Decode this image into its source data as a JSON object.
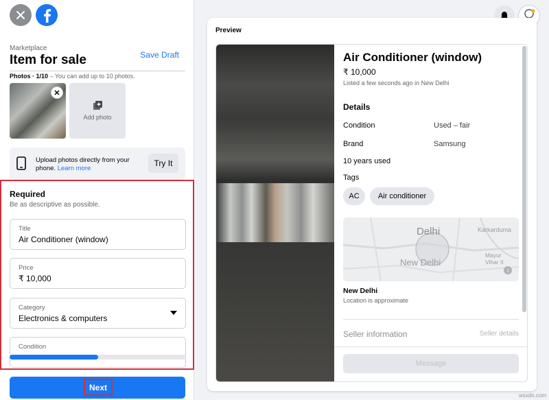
{
  "header": {
    "breadcrumb": "Marketplace",
    "title": "Item for sale",
    "save_draft": "Save Draft"
  },
  "photos": {
    "caption_bold": "Photos · 1/10",
    "caption_rest": " – You can add up to 10 photos.",
    "add_photo": "Add photo"
  },
  "upload": {
    "text": "Upload photos directly from your phone.",
    "learn_more": "Learn more",
    "try_it": "Try It"
  },
  "required": {
    "title": "Required",
    "subtitle": "Be as descriptive as possible.",
    "fields": [
      {
        "label": "Title",
        "value": "Air Conditioner (window)"
      },
      {
        "label": "Price",
        "value": "₹ 10,000"
      },
      {
        "label": "Category",
        "value": "Electronics & computers"
      },
      {
        "label": "Condition",
        "value": ""
      }
    ],
    "progress_fraction": 0.5
  },
  "next_label": "Next",
  "preview": {
    "label": "Preview",
    "item_title": "Air Conditioner (window)",
    "price": "₹ 10,000",
    "listed": "Listed a few seconds ago in New Delhi",
    "details_heading": "Details",
    "details": [
      {
        "key": "Condition",
        "value": "Used – fair"
      },
      {
        "key": "Brand",
        "value": "Samsung"
      }
    ],
    "usage": "10 years used",
    "tags_heading": "Tags",
    "tags": [
      "AC",
      "Air conditioner"
    ],
    "map": {
      "city": "Delhi",
      "area": "New Delhi",
      "karkarduma": "Karkarduma",
      "mayur": "Mayur",
      "vihar": "Vihar II"
    },
    "location_name": "New Delhi",
    "location_note": "Location is approximate",
    "seller_heading": "Seller information",
    "seller_details": "Seller details",
    "message": "Message"
  },
  "watermark": "wsxdn.com",
  "colors": {
    "accent": "#1877f2",
    "highlight": "#d0303a"
  }
}
